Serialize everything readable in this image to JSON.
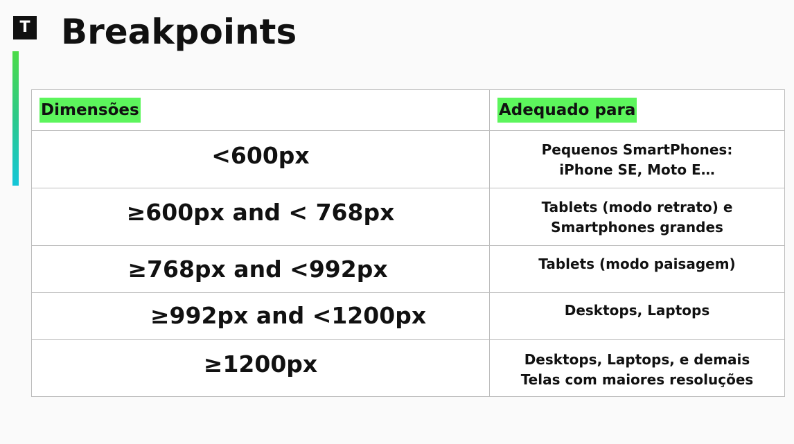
{
  "slide": {
    "logo_letter": "T",
    "title": "Breakpoints"
  },
  "table": {
    "headers": [
      "Dimensões",
      "Adequado para"
    ],
    "rows": [
      {
        "dimension": "<600px",
        "suitable_for": "Pequenos SmartPhones:\niPhone SE, Moto E…"
      },
      {
        "dimension": "≥600px and < 768px",
        "suitable_for": "Tablets (modo retrato) e\nSmartphones grandes"
      },
      {
        "dimension": "≥768px and <992px",
        "suitable_for": "Tablets (modo paisagem)"
      },
      {
        "dimension": "≥992px and <1200px",
        "suitable_for": "Desktops, Laptops"
      },
      {
        "dimension": "≥1200px",
        "suitable_for": "Desktops, Laptops, e demais\nTelas com maiores resoluções"
      }
    ]
  },
  "colors": {
    "header_highlight": "#5cf55c",
    "accent_gradient": [
      "#4cdb48",
      "#14c6d9"
    ]
  }
}
